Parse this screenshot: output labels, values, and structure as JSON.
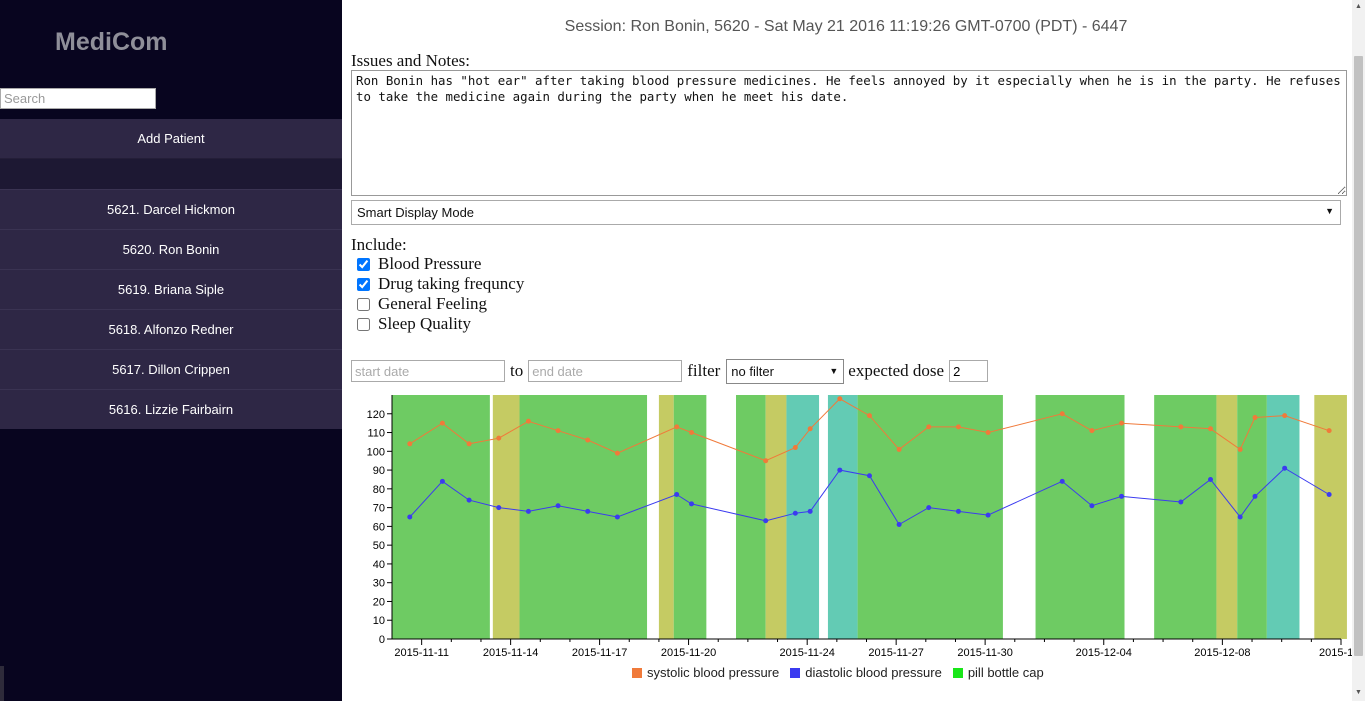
{
  "app": {
    "logo": "MediCom"
  },
  "sidebar": {
    "search_placeholder": "Search",
    "add_patient_label": "Add Patient",
    "patients": [
      "5621. Darcel Hickmon",
      "5620. Ron Bonin",
      "5619. Briana Siple",
      "5618. Alfonzo Redner",
      "5617. Dillon Crippen",
      "5616. Lizzie Fairbairn"
    ]
  },
  "main": {
    "session_title": "Session: Ron Bonin, 5620 - Sat May 21 2016 11:19:26 GMT-0700 (PDT) - 6447",
    "notes_label": "Issues and Notes:",
    "notes_text": "Ron Bonin has \"hot ear\" after taking blood pressure medicines. He feels annoyed by it especially when he is in the party. He refuses to take the medicine again during the party when he meet his date.",
    "display_mode": "Smart Display Mode",
    "include_label": "Include:",
    "include_options": [
      {
        "label": "Blood Pressure",
        "checked": true
      },
      {
        "label": "Drug taking frequncy",
        "checked": true
      },
      {
        "label": "General Feeling",
        "checked": false
      },
      {
        "label": "Sleep Quality",
        "checked": false
      }
    ],
    "start_date_placeholder": "start date",
    "to_label": "to",
    "end_date_placeholder": "end date",
    "filter_label": "filter",
    "filter_value": "no filter",
    "expected_dose_label": "expected dose",
    "expected_dose_value": "2"
  },
  "colors": {
    "sidebar_bg": "#08051f",
    "sidebar_item_bg": "#2e2745",
    "systolic": "#f07a3a",
    "diastolic": "#3b3bf0",
    "pill_green": "#6ecb63",
    "pill_yellow": "#c5cb63",
    "pill_teal": "#63cbb4",
    "legend_pill": "#19e619"
  },
  "chart_data": {
    "type": "line",
    "x_start": "2015-11-10",
    "x_end": "2015-12-12",
    "ylim": [
      0,
      130
    ],
    "y_ticks": [
      0,
      10,
      20,
      30,
      40,
      50,
      60,
      70,
      80,
      90,
      100,
      110,
      120
    ],
    "x_tick_labels": [
      {
        "date": "2015-11-11",
        "label": "2015-11-11"
      },
      {
        "date": "2015-11-14",
        "label": "2015-11-14"
      },
      {
        "date": "2015-11-17",
        "label": "2015-11-17"
      },
      {
        "date": "2015-11-20",
        "label": "2015-11-20"
      },
      {
        "date": "2015-11-24",
        "label": "2015-11-24"
      },
      {
        "date": "2015-11-27",
        "label": "2015-11-27"
      },
      {
        "date": "2015-11-30",
        "label": "2015-11-30"
      },
      {
        "date": "2015-12-04",
        "label": "2015-12-04"
      },
      {
        "date": "2015-12-08",
        "label": "2015-12-08"
      },
      {
        "date": "2015-12-12",
        "label": "2015-12-"
      }
    ],
    "x_minor_ticks": [
      "2015-11-12",
      "2015-11-13",
      "2015-11-15",
      "2015-11-16",
      "2015-11-18",
      "2015-11-19",
      "2015-11-21",
      "2015-11-22",
      "2015-11-23",
      "2015-11-25",
      "2015-11-26",
      "2015-11-28",
      "2015-11-29",
      "2015-12-01",
      "2015-12-02",
      "2015-12-03",
      "2015-12-05",
      "2015-12-06",
      "2015-12-07",
      "2015-12-09",
      "2015-12-10",
      "2015-12-11"
    ],
    "pill_intervals": [
      {
        "start": "2015-11-10",
        "end": "2015-11-13.3",
        "color": "green"
      },
      {
        "start": "2015-11-13.4",
        "end": "2015-11-14.3",
        "color": "yellow"
      },
      {
        "start": "2015-11-14.3",
        "end": "2015-11-18.6",
        "color": "green"
      },
      {
        "start": "2015-11-19",
        "end": "2015-11-19.5",
        "color": "yellow"
      },
      {
        "start": "2015-11-19.5",
        "end": "2015-11-20.6",
        "color": "green"
      },
      {
        "start": "2015-11-21.6",
        "end": "2015-11-22.6",
        "color": "green"
      },
      {
        "start": "2015-11-22.6",
        "end": "2015-11-23.3",
        "color": "yellow"
      },
      {
        "start": "2015-11-23.3",
        "end": "2015-11-24.4",
        "color": "teal"
      },
      {
        "start": "2015-11-24.7",
        "end": "2015-11-25.7",
        "color": "teal"
      },
      {
        "start": "2015-11-25.7",
        "end": "2015-11-30.6",
        "color": "green"
      },
      {
        "start": "2015-12-01.7",
        "end": "2015-12-04.7",
        "color": "green"
      },
      {
        "start": "2015-12-05.7",
        "end": "2015-12-07.8",
        "color": "green"
      },
      {
        "start": "2015-12-07.8",
        "end": "2015-12-08.5",
        "color": "yellow"
      },
      {
        "start": "2015-12-08.5",
        "end": "2015-12-09.5",
        "color": "green"
      },
      {
        "start": "2015-12-09.5",
        "end": "2015-12-10.6",
        "color": "teal"
      },
      {
        "start": "2015-12-11.1",
        "end": "2015-12-12.2",
        "color": "yellow"
      }
    ],
    "series": [
      {
        "name": "systolic blood pressure",
        "points": [
          [
            "2015-11-10.6",
            104
          ],
          [
            "2015-11-11.7",
            115
          ],
          [
            "2015-11-12.6",
            104
          ],
          [
            "2015-11-13.6",
            107
          ],
          [
            "2015-11-14.6",
            116
          ],
          [
            "2015-11-15.6",
            111
          ],
          [
            "2015-11-16.6",
            106
          ],
          [
            "2015-11-17.6",
            99
          ],
          [
            "2015-11-19.6",
            113
          ],
          [
            "2015-11-20.1",
            110
          ],
          [
            "2015-11-22.6",
            95
          ],
          [
            "2015-11-23.6",
            102
          ],
          [
            "2015-11-24.1",
            112
          ],
          [
            "2015-11-25.1",
            128
          ],
          [
            "2015-11-26.1",
            119
          ],
          [
            "2015-11-27.1",
            101
          ],
          [
            "2015-11-28.1",
            113
          ],
          [
            "2015-11-29.1",
            113
          ],
          [
            "2015-11-30.1",
            110
          ],
          [
            "2015-12-02.6",
            120
          ],
          [
            "2015-12-03.6",
            111
          ],
          [
            "2015-12-04.6",
            115
          ],
          [
            "2015-12-06.6",
            113
          ],
          [
            "2015-12-07.6",
            112
          ],
          [
            "2015-12-08.6",
            101
          ],
          [
            "2015-12-09.1",
            118
          ],
          [
            "2015-12-10.1",
            119
          ],
          [
            "2015-12-11.6",
            111
          ]
        ]
      },
      {
        "name": "diastolic blood pressure",
        "points": [
          [
            "2015-11-10.6",
            65
          ],
          [
            "2015-11-11.7",
            84
          ],
          [
            "2015-11-12.6",
            74
          ],
          [
            "2015-11-13.6",
            70
          ],
          [
            "2015-11-14.6",
            68
          ],
          [
            "2015-11-15.6",
            71
          ],
          [
            "2015-11-16.6",
            68
          ],
          [
            "2015-11-17.6",
            65
          ],
          [
            "2015-11-19.6",
            77
          ],
          [
            "2015-11-20.1",
            72
          ],
          [
            "2015-11-22.6",
            63
          ],
          [
            "2015-11-23.6",
            67
          ],
          [
            "2015-11-24.1",
            68
          ],
          [
            "2015-11-25.1",
            90
          ],
          [
            "2015-11-26.1",
            87
          ],
          [
            "2015-11-27.1",
            61
          ],
          [
            "2015-11-28.1",
            70
          ],
          [
            "2015-11-29.1",
            68
          ],
          [
            "2015-11-30.1",
            66
          ],
          [
            "2015-12-02.6",
            84
          ],
          [
            "2015-12-03.6",
            71
          ],
          [
            "2015-12-04.6",
            76
          ],
          [
            "2015-12-06.6",
            73
          ],
          [
            "2015-12-07.6",
            85
          ],
          [
            "2015-12-08.6",
            65
          ],
          [
            "2015-12-09.1",
            76
          ],
          [
            "2015-12-10.1",
            91
          ],
          [
            "2015-12-11.6",
            77
          ]
        ]
      }
    ],
    "legend": [
      {
        "label": "systolic blood pressure",
        "color": "#f07a3a"
      },
      {
        "label": "diastolic blood pressure",
        "color": "#3b3bf0"
      },
      {
        "label": "pill bottle cap",
        "color": "#19e619"
      }
    ],
    "legend_position": "bottom"
  }
}
